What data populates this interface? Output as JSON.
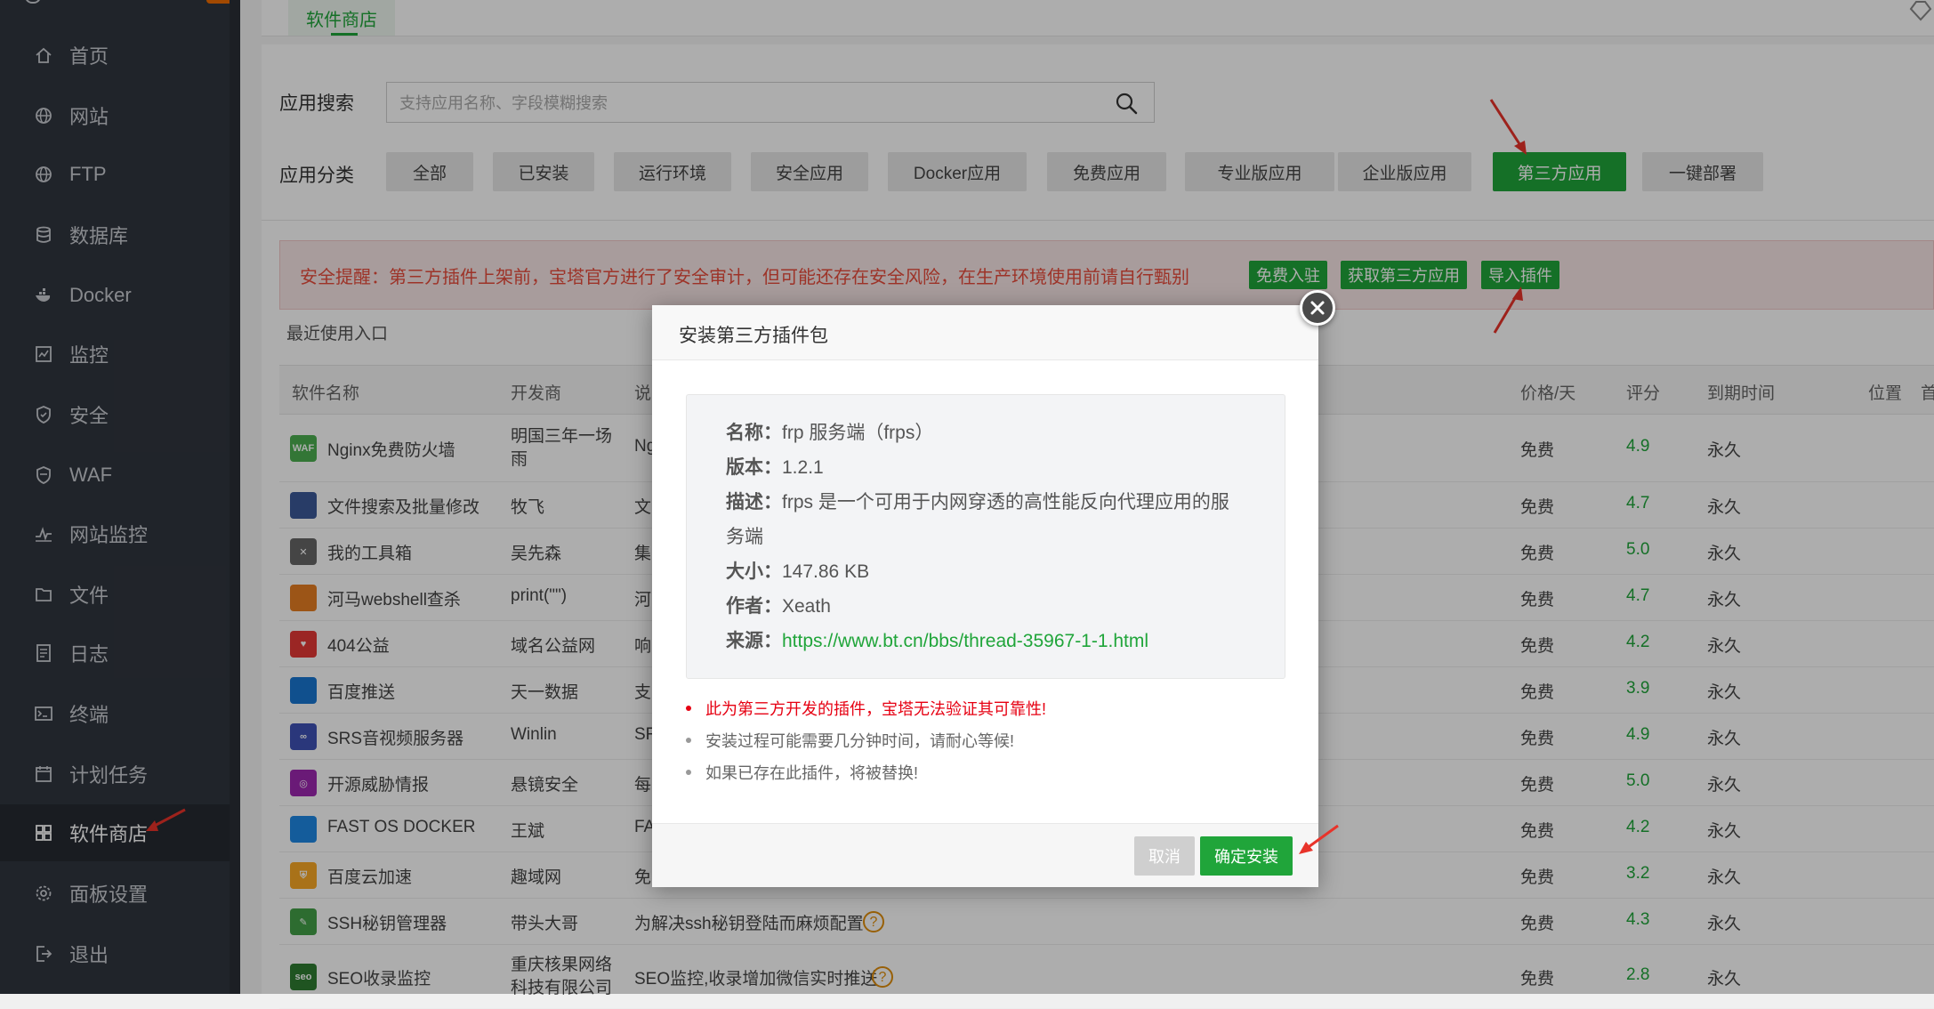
{
  "sidebar": {
    "items": [
      {
        "label": "首页",
        "icon": "home-icon"
      },
      {
        "label": "网站",
        "icon": "globe-icon"
      },
      {
        "label": "FTP",
        "icon": "ftp-globe-icon"
      },
      {
        "label": "数据库",
        "icon": "database-icon"
      },
      {
        "label": "Docker",
        "icon": "docker-icon"
      },
      {
        "label": "监控",
        "icon": "monitor-chart-icon"
      },
      {
        "label": "安全",
        "icon": "shield-icon"
      },
      {
        "label": "WAF",
        "icon": "waf-shield-icon"
      },
      {
        "label": "网站监控",
        "icon": "pulse-icon"
      },
      {
        "label": "文件",
        "icon": "folder-icon"
      },
      {
        "label": "日志",
        "icon": "log-icon"
      },
      {
        "label": "终端",
        "icon": "terminal-icon"
      },
      {
        "label": "计划任务",
        "icon": "calendar-icon"
      },
      {
        "label": "软件商店",
        "icon": "grid-apps-icon"
      },
      {
        "label": "面板设置",
        "icon": "gear-icon"
      },
      {
        "label": "退出",
        "icon": "logout-icon"
      }
    ],
    "active_index": 13
  },
  "tabs": {
    "store": "软件商店"
  },
  "search": {
    "label": "应用搜索",
    "placeholder": "支持应用名称、字段模糊搜索"
  },
  "categories": {
    "label": "应用分类",
    "items": [
      "全部",
      "已安装",
      "运行环境",
      "安全应用",
      "Docker应用",
      "免费应用",
      "专业版应用",
      "企业版应用",
      "第三方应用",
      "一键部署"
    ],
    "active_index": 8
  },
  "alert": {
    "text": "安全提醒：第三方插件上架前，宝塔官方进行了安全审计，但可能还存在安全风险，在生产环境使用前请自行甄别",
    "buttons": [
      "免费入驻",
      "获取第三方应用",
      "导入插件"
    ]
  },
  "recent": {
    "label": "最近使用入口"
  },
  "table": {
    "headers": {
      "name": "软件名称",
      "dev": "开发商",
      "desc": "说",
      "price": "价格/天",
      "score": "评分",
      "expire": "到期时间",
      "position": "位置",
      "home": "首"
    },
    "rows": [
      {
        "name": "Nginx免费防火墙",
        "dev": "明国三年一场雨",
        "desc": "Ng",
        "price": "免费",
        "score": "4.9",
        "expire": "永久",
        "icon_color": "#4caf50",
        "icon_text": "WAF"
      },
      {
        "name": "文件搜索及批量修改",
        "dev": "牧飞",
        "desc": "文",
        "price": "免费",
        "score": "4.7",
        "expire": "永久",
        "icon_color": "#3b5998",
        "icon_text": ""
      },
      {
        "name": "我的工具箱",
        "dev": "吴先森",
        "desc": "集",
        "price": "免费",
        "score": "5.0",
        "expire": "永久",
        "icon_color": "#666666",
        "icon_text": "✕"
      },
      {
        "name": "河马webshell查杀",
        "dev": "print(\"\")",
        "desc": "河",
        "price": "免费",
        "score": "4.7",
        "expire": "永久",
        "icon_color": "#e67e22",
        "icon_text": ""
      },
      {
        "name": "404公益",
        "dev": "域名公益网",
        "desc": "响",
        "price": "免费",
        "score": "4.2",
        "expire": "永久",
        "icon_color": "#e53935",
        "icon_text": "♥"
      },
      {
        "name": "百度推送",
        "dev": "天一数据",
        "desc": "支",
        "price": "免费",
        "score": "3.9",
        "expire": "永久",
        "icon_color": "#1976d2",
        "icon_text": ""
      },
      {
        "name": "SRS音视频服务器",
        "dev": "Winlin",
        "desc": "SR",
        "price": "免费",
        "score": "4.9",
        "expire": "永久",
        "icon_color": "#3f51b5",
        "icon_text": "∞"
      },
      {
        "name": "开源威胁情报",
        "dev": "悬镜安全",
        "desc": "每",
        "price": "免费",
        "score": "5.0",
        "expire": "永久",
        "icon_color": "#9c27b0",
        "icon_text": "◎"
      },
      {
        "name": "FAST OS DOCKER",
        "dev": "王斌",
        "desc": "FA",
        "price": "免费",
        "score": "4.2",
        "expire": "永久",
        "icon_color": "#1e88e5",
        "icon_text": ""
      },
      {
        "name": "百度云加速",
        "dev": "趣域网",
        "desc": "免",
        "price": "免费",
        "score": "3.2",
        "expire": "永久",
        "icon_color": "#f9a825",
        "icon_text": "⛨"
      },
      {
        "name": "SSH秘钥管理器",
        "dev": "带头大哥",
        "desc": "为解决ssh秘钥登陆而麻烦配置",
        "price": "免费",
        "score": "4.3",
        "expire": "永久",
        "icon_color": "#43a047",
        "icon_text": "✎"
      },
      {
        "name": "SEO收录监控",
        "dev": "重庆核果网络科技有限公司",
        "desc": "SEO监控,收录增加微信实时推送",
        "price": "免费",
        "score": "2.8",
        "expire": "永久",
        "icon_color": "#2e7d32",
        "icon_text": "seo"
      }
    ]
  },
  "modal": {
    "title": "安装第三方插件包",
    "fields": [
      {
        "key": "名称：",
        "value": "frp 服务端（frps）"
      },
      {
        "key": "版本：",
        "value": "1.2.1"
      },
      {
        "key": "描述：",
        "value": "frps 是一个可用于内网穿透的高性能反向代理应用的服"
      },
      {
        "key": "",
        "value": "务端"
      },
      {
        "key": "大小：",
        "value": "147.86 KB"
      },
      {
        "key": "作者：",
        "value": "Xeath"
      },
      {
        "key": "来源：",
        "value": "https://www.bt.cn/bbs/thread-35967-1-1.html"
      }
    ],
    "notes": [
      "此为第三方开发的插件，宝塔无法验证其可靠性!",
      "安装过程可能需要几分钟时间，请耐心等候!",
      "如果已存在此插件，将被替换!"
    ],
    "cancel": "取消",
    "confirm": "确定安装"
  },
  "colors": {
    "accent": "#20a53a",
    "sidebar": "#30353e",
    "warn": "#e60012",
    "arrow": "#e8332a"
  }
}
